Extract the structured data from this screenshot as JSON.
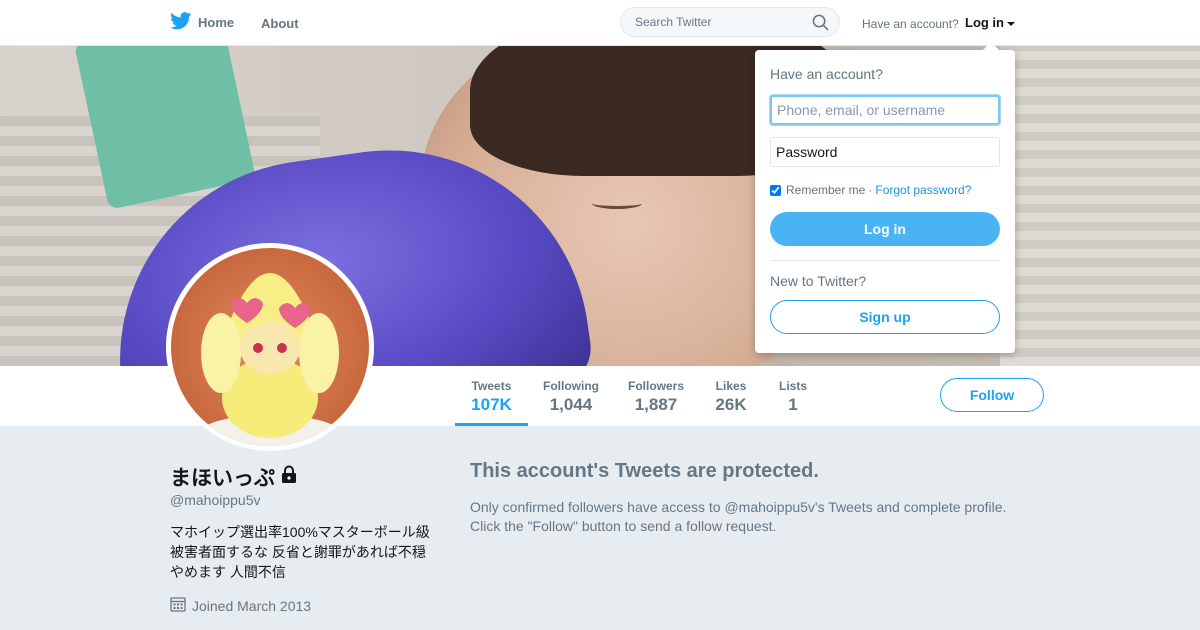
{
  "nav": {
    "home_label": "Home",
    "about_label": "About",
    "search_placeholder": "Search Twitter",
    "have_account": "Have an account?",
    "login_label": "Log in"
  },
  "profile": {
    "name": "まほいっぷ",
    "handle": "@mahoippu5v",
    "bio_lines": [
      "マホイップ選出率100%マスターボール級",
      "被害者面するな 反省と謝罪があれば不穏",
      "やめます 人間不信"
    ],
    "joined": "Joined March 2013"
  },
  "stats": [
    {
      "label": "Tweets",
      "value": "107K"
    },
    {
      "label": "Following",
      "value": "1,044"
    },
    {
      "label": "Followers",
      "value": "1,887"
    },
    {
      "label": "Likes",
      "value": "26K"
    },
    {
      "label": "Lists",
      "value": "1"
    }
  ],
  "follow_label": "Follow",
  "protected": {
    "title": "This account's Tweets are protected.",
    "line1": "Only confirmed followers have access to @mahoippu5v's Tweets and complete profile.",
    "line2": "Click the \"Follow\" button to send a follow request."
  },
  "login_dropdown": {
    "title": "Have an account?",
    "username_placeholder": "Phone, email, or username",
    "password_placeholder": "Password",
    "remember_label": "Remember me",
    "separator": "·",
    "forgot_label": "Forgot password?",
    "login_button": "Log in",
    "new_to": "New to Twitter?",
    "signup_button": "Sign up"
  },
  "colors": {
    "accent": "#1da1f2",
    "login_button": "#4ab3f4",
    "page_bg": "#e6ecf0"
  }
}
